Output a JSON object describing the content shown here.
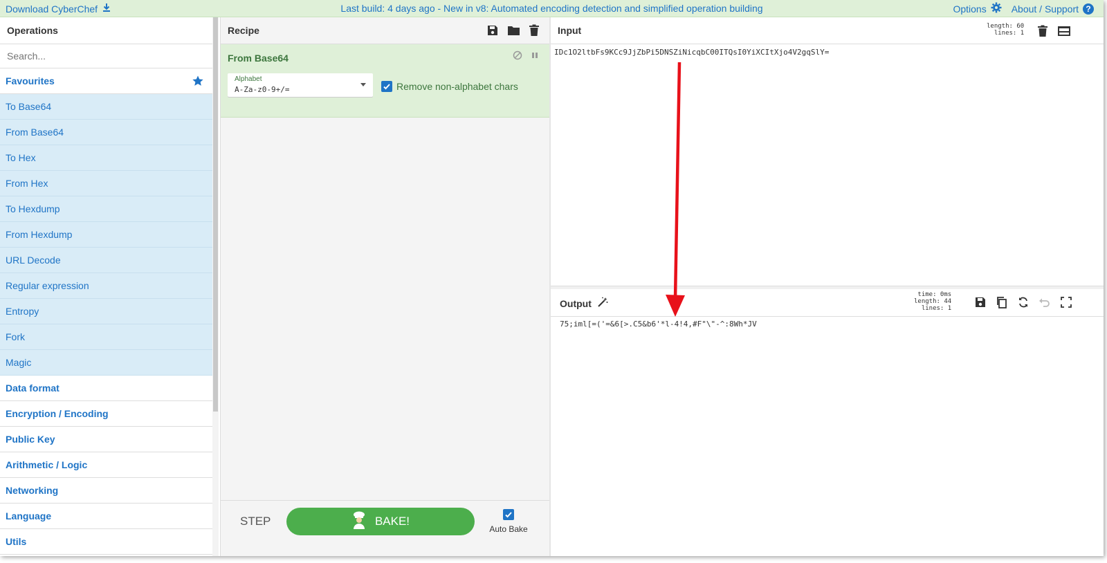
{
  "banner": {
    "download_label": "Download CyberChef",
    "center_text": "Last build: 4 days ago - New in v8: Automated encoding detection and simplified operation building",
    "options_label": "Options",
    "about_label": "About / Support"
  },
  "operations": {
    "title": "Operations",
    "search_placeholder": "Search...",
    "favourites_label": "Favourites",
    "favourites": [
      "To Base64",
      "From Base64",
      "To Hex",
      "From Hex",
      "To Hexdump",
      "From Hexdump",
      "URL Decode",
      "Regular expression",
      "Entropy",
      "Fork",
      "Magic"
    ],
    "categories": [
      "Data format",
      "Encryption / Encoding",
      "Public Key",
      "Arithmetic / Logic",
      "Networking",
      "Language",
      "Utils"
    ]
  },
  "recipe": {
    "title": "Recipe",
    "operation": {
      "name": "From Base64",
      "alphabet_label": "Alphabet",
      "alphabet_value": "A-Za-z0-9+/=",
      "remove_non_alpha_label": "Remove non-alphabet chars",
      "remove_non_alpha_checked": true
    },
    "step_label": "STEP",
    "bake_label": "BAKE!",
    "auto_bake_label": "Auto Bake",
    "auto_bake_checked": true
  },
  "input": {
    "title": "Input",
    "stats_length": "length:  60",
    "stats_lines": "lines:   1",
    "value": "IDc1O2ltbFs9KCc9JjZbPi5DNSZiNicqbC00ITQsI0YiXCItXjo4V2gqSlY="
  },
  "output": {
    "title": "Output",
    "stats_time": "time:   0ms",
    "stats_length": "length:  44",
    "stats_lines": "lines:   1",
    "value": "75;iml[=('=&6[>.C5&b6'*l-4!4,#F\"\\\"-^:8Wh*JV"
  },
  "colors": {
    "accent": "#1f74c6",
    "banner_bg": "#dff0d8",
    "favourites_bg": "#d9ecf7",
    "bake_green": "#4cae4c",
    "annotation_red": "#e8111a"
  }
}
